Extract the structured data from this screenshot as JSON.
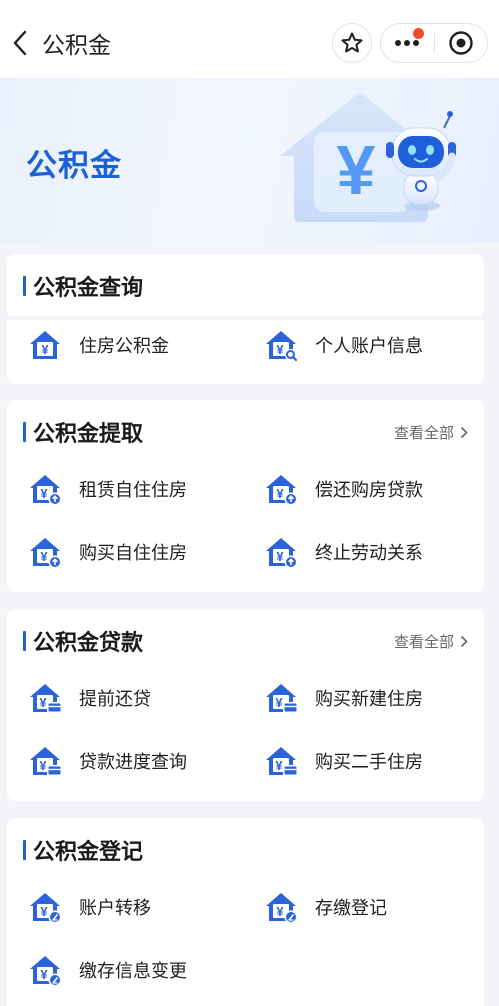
{
  "nav": {
    "title": "公积金"
  },
  "banner": {
    "title": "公积金",
    "currency_symbol": "¥"
  },
  "sections": [
    {
      "title": "公积金查询",
      "see_all": "",
      "items": [
        {
          "label": "住房公积金",
          "icon": "house-yuan-icon"
        },
        {
          "label": "个人账户信息",
          "icon": "house-yuan-search-icon"
        }
      ]
    },
    {
      "title": "公积金提取",
      "see_all": "查看全部",
      "items": [
        {
          "label": "租赁自住住房",
          "icon": "house-yuan-withdraw-icon"
        },
        {
          "label": "偿还购房贷款",
          "icon": "house-yuan-withdraw-icon"
        },
        {
          "label": "购买自住住房",
          "icon": "house-yuan-withdraw-icon"
        },
        {
          "label": "终止劳动关系",
          "icon": "house-yuan-withdraw-icon"
        }
      ]
    },
    {
      "title": "公积金贷款",
      "see_all": "查看全部",
      "items": [
        {
          "label": "提前还贷",
          "icon": "house-yuan-card-icon"
        },
        {
          "label": "购买新建住房",
          "icon": "house-yuan-card-icon"
        },
        {
          "label": "贷款进度查询",
          "icon": "house-yuan-card-icon"
        },
        {
          "label": "购买二手住房",
          "icon": "house-yuan-card-icon"
        }
      ]
    },
    {
      "title": "公积金登记",
      "see_all": "",
      "items": [
        {
          "label": "账户转移",
          "icon": "house-yuan-edit-icon"
        },
        {
          "label": "存缴登记",
          "icon": "house-yuan-edit-icon"
        },
        {
          "label": "缴存信息变更",
          "icon": "house-yuan-edit-icon"
        }
      ]
    }
  ],
  "colors": {
    "accent": "#1a62d6",
    "icon_blue": "#2b63d9",
    "background": "#f2f4f7"
  }
}
